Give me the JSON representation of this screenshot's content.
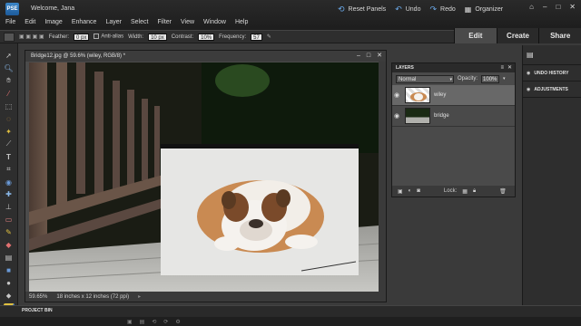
{
  "app": {
    "logo": "PSE",
    "welcome": "Welcome, Jana"
  },
  "menu": [
    "File",
    "Edit",
    "Image",
    "Enhance",
    "Layer",
    "Select",
    "Filter",
    "View",
    "Window",
    "Help"
  ],
  "top_actions": {
    "reset_panels": "Reset Panels",
    "undo": "Undo",
    "redo": "Redo",
    "organizer": "Organizer"
  },
  "options_bar": {
    "feather_label": "Feather:",
    "feather_value": "0 px",
    "antialias_label": "Anti-alias",
    "width_label": "Width:",
    "width_value": "10 px",
    "contrast_label": "Contrast:",
    "contrast_value": "10%",
    "frequency_label": "Frequency:",
    "frequency_value": "57"
  },
  "mode_tabs": [
    "Edit",
    "Create",
    "Share"
  ],
  "document": {
    "title": "Bridge12.jpg @ 59.6% (wiley, RGB/8) *",
    "zoom": "59.65%",
    "doc_size": "18 inches x 12 inches (72 ppi)"
  },
  "layers_panel": {
    "title": "LAYERS",
    "blend_mode": "Normal",
    "opacity_label": "Opacity:",
    "opacity_value": "100%",
    "lock_label": "Lock:",
    "layers": [
      {
        "name": "wiley",
        "active": true
      },
      {
        "name": "bridge",
        "active": false
      }
    ]
  },
  "right_panels": {
    "undo_history": "UNDO HISTORY",
    "adjustments": "ADJUSTMENTS"
  },
  "project_bin": {
    "label": "PROJECT BIN"
  },
  "colors": {
    "accent": "#3b86c7",
    "panel_bg": "#4a4a4a",
    "chrome_bg": "#2e2e2e"
  }
}
